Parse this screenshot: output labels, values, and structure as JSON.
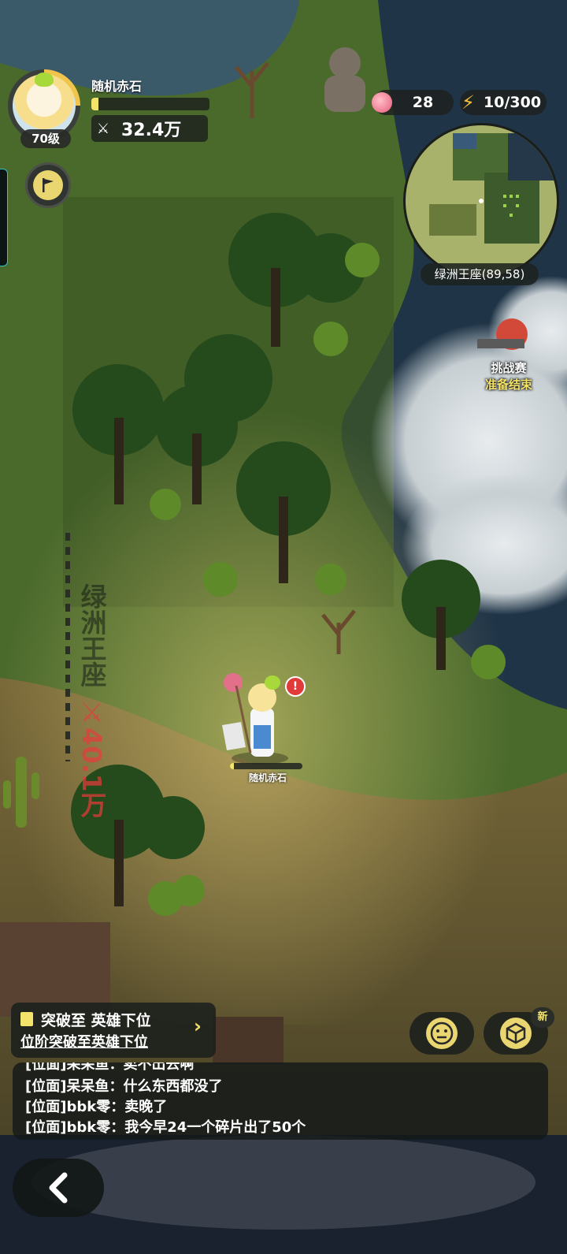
{
  "player": {
    "name": "随机赤石",
    "level": "70级",
    "power": "32.4万",
    "xp_fraction": 0.06
  },
  "resources": {
    "peach": "28",
    "energy": "10/300"
  },
  "minimap": {
    "location": "绿洲王座(89,58)"
  },
  "event": {
    "title": "挑战赛",
    "status": "准备结束"
  },
  "territory": {
    "name": "绿洲王座",
    "power": "40.1万"
  },
  "character": {
    "name": "随机赤石",
    "hp_fraction": 0.05
  },
  "quest": {
    "title": "突破至 英雄下位",
    "desc": "位阶突破至英雄下位"
  },
  "badges": {
    "new": "新"
  },
  "chat": [
    "[位面]呆呆鱼：卖不出去啊",
    "[位面]呆呆鱼：什么东西都没了",
    "[位面]bbk零：卖晚了",
    "[位面]bbk零：我今早24一个碎片出了50个"
  ],
  "colors": {
    "accent_yellow": "#f3e36a",
    "territory_power_red": "#e63c3c",
    "panel_dark": "#191e1c",
    "grass": "#4d6a2e",
    "water": "#2f4a5c"
  }
}
